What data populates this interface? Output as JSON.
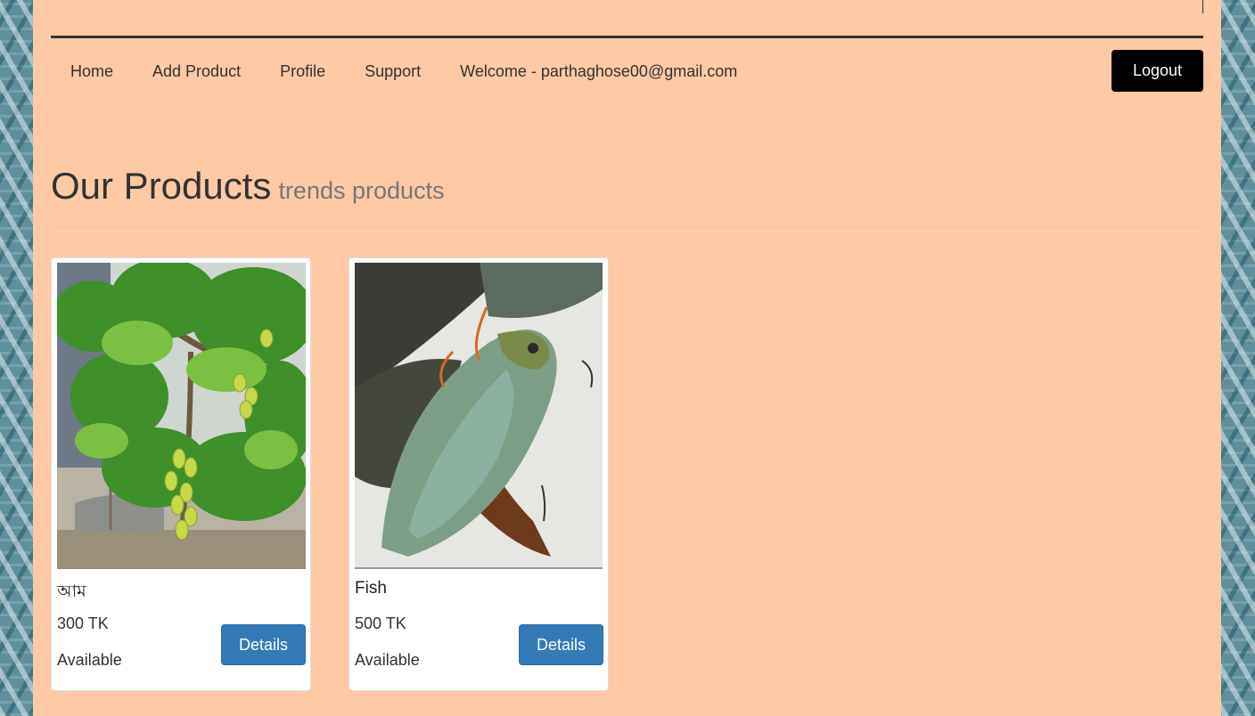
{
  "nav": {
    "items": [
      {
        "label": "Home"
      },
      {
        "label": "Add Product"
      },
      {
        "label": "Profile"
      },
      {
        "label": "Support"
      },
      {
        "label": "Welcome - parthaghose00@gmail.com"
      }
    ],
    "logout_label": "Logout"
  },
  "header": {
    "title": "Our Products",
    "subtitle": "trends products"
  },
  "products": [
    {
      "name": "আম",
      "price": "300 TK",
      "status": "Available",
      "details_label": "Details",
      "image": "mango-tree-photo"
    },
    {
      "name": "Fish",
      "price": "500 TK",
      "status": "Available",
      "details_label": "Details",
      "image": "fish-photo"
    }
  ],
  "colors": {
    "page_background": "#fec9a5",
    "logout_button": "#000000",
    "details_button": "#337ab7"
  }
}
